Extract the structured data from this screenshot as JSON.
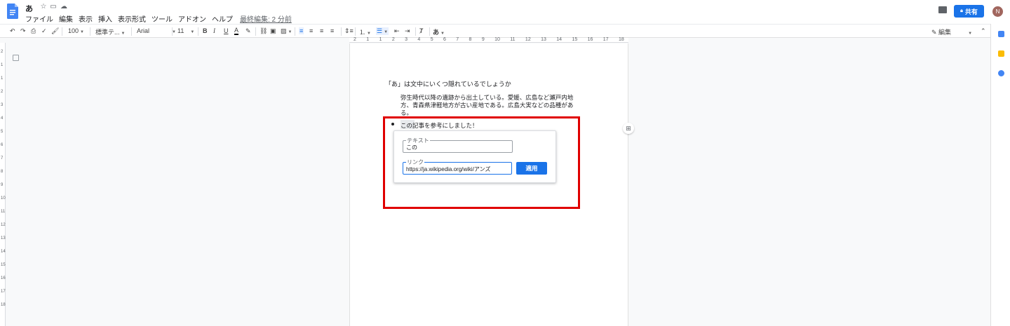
{
  "header": {
    "doc_title": "あ",
    "menu": [
      "ファイル",
      "編集",
      "表示",
      "挿入",
      "表示形式",
      "ツール",
      "アドオン",
      "ヘルプ"
    ],
    "last_edit": "最終編集: 2 分前",
    "share_label": "共有",
    "avatar_initial": "N"
  },
  "toolbar": {
    "zoom": "100",
    "style": "標準テ...",
    "font": "Arial",
    "font_size": "11",
    "bold": "B",
    "italic": "I",
    "underline": "U",
    "text_color": "A",
    "input_tools": "あ",
    "mode": "編集"
  },
  "ruler": {
    "labels": [
      "2",
      "1",
      "1",
      "2",
      "3",
      "4",
      "5",
      "6",
      "7",
      "8",
      "9",
      "10",
      "11",
      "12",
      "13",
      "14",
      "15",
      "16",
      "17",
      "18"
    ],
    "vertical_labels": [
      "2",
      "1",
      "1",
      "2",
      "3",
      "4",
      "5",
      "6",
      "7",
      "8",
      "9",
      "10",
      "11",
      "12",
      "13",
      "14",
      "15",
      "16",
      "17",
      "18"
    ]
  },
  "document": {
    "question": "「あ」は文中にいくつ隠れているでしょうか",
    "paragraph": "弥生時代以降の遺跡から出土している。愛媛、広島など瀬戸内地方、青森県津軽地方が古い産地である。広島大実などの品種がある。",
    "bullet": "この記事を参考にしました！"
  },
  "link_dialog": {
    "text_label": "テキスト",
    "text_value": "この",
    "link_label": "リンク",
    "link_value": "https://ja.wikipedia.org/wiki/アンズ",
    "apply_label": "適用"
  },
  "colors": {
    "accent": "#1a73e8",
    "highlight_box": "#e00000",
    "avatar": "#a1665e"
  }
}
